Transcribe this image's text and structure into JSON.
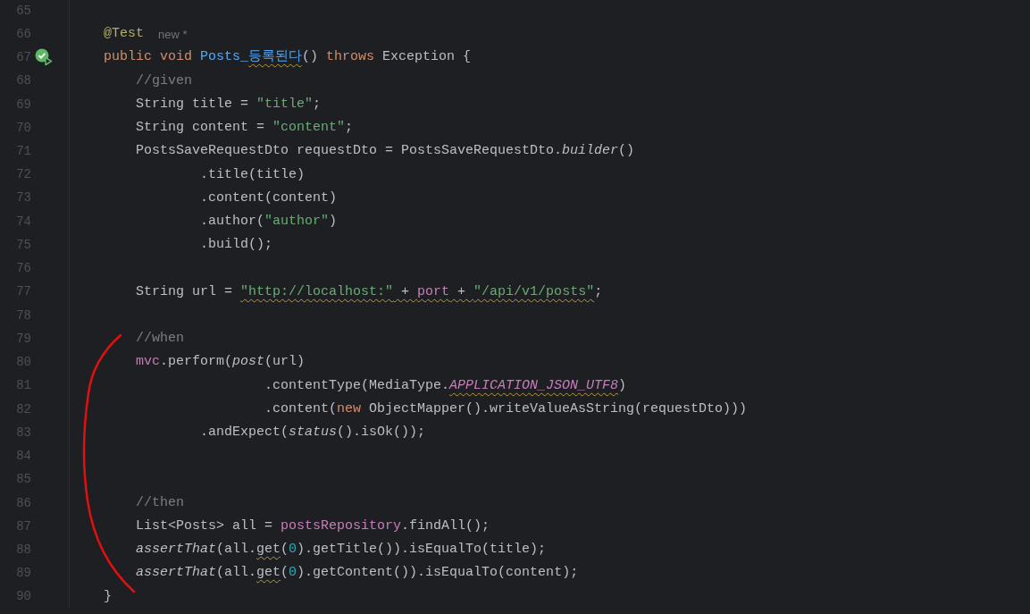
{
  "editor": {
    "lines": [
      {
        "number": "65"
      },
      {
        "number": "66",
        "kind": "top",
        "tokens": [
          {
            "annotation": "@Test"
          },
          {
            "hint": "new *"
          }
        ]
      },
      {
        "number": "67",
        "kind": "top",
        "run_icon": true,
        "tokens": [
          {
            "keyword": "public void "
          },
          {
            "declaration": "Posts_"
          },
          {
            "declaration": "등록된다",
            "warn": true
          },
          {
            "plain": "() "
          },
          {
            "keyword": "throws "
          },
          {
            "plain": "Exception {"
          }
        ]
      },
      {
        "number": "68",
        "kind": "body",
        "tokens": [
          {
            "comment": "//given"
          }
        ]
      },
      {
        "number": "69",
        "kind": "body",
        "tokens": [
          {
            "plain": "String title = "
          },
          {
            "string": "\"title\""
          },
          {
            "plain": ";"
          }
        ]
      },
      {
        "number": "70",
        "kind": "body",
        "tokens": [
          {
            "plain": "String content = "
          },
          {
            "string": "\"content\""
          },
          {
            "plain": ";"
          }
        ]
      },
      {
        "number": "71",
        "kind": "body",
        "tokens": [
          {
            "plain": "PostsSaveRequestDto requestDto = PostsSaveRequestDto."
          },
          {
            "italic": "builder"
          },
          {
            "plain": "()"
          }
        ]
      },
      {
        "number": "72",
        "kind": "chain",
        "tokens": [
          {
            "plain": ".title(title)"
          }
        ]
      },
      {
        "number": "73",
        "kind": "chain",
        "tokens": [
          {
            "plain": ".content(content)"
          }
        ]
      },
      {
        "number": "74",
        "kind": "chain",
        "tokens": [
          {
            "plain": ".author("
          },
          {
            "string": "\"author\""
          },
          {
            "plain": ")"
          }
        ]
      },
      {
        "number": "75",
        "kind": "chain",
        "tokens": [
          {
            "plain": ".build();"
          }
        ]
      },
      {
        "number": "76"
      },
      {
        "number": "77",
        "kind": "body",
        "tokens": [
          {
            "plain": "String url = "
          },
          {
            "string": "\"http://localhost:\"",
            "warn": true
          },
          {
            "plain": " + ",
            "warn": true
          },
          {
            "field": "port",
            "warn": true
          },
          {
            "plain": " + ",
            "warn": true
          },
          {
            "string": "\"/api/v1/posts\"",
            "warn": true
          },
          {
            "plain": ";"
          }
        ]
      },
      {
        "number": "78"
      },
      {
        "number": "79",
        "kind": "body",
        "tokens": [
          {
            "comment": "//when"
          }
        ]
      },
      {
        "number": "80",
        "kind": "body",
        "tokens": [
          {
            "field": "mvc"
          },
          {
            "plain": ".perform("
          },
          {
            "italic": "post"
          },
          {
            "plain": "(url)"
          }
        ]
      },
      {
        "number": "81",
        "kind": "chain_deep",
        "tokens": [
          {
            "plain": ".contentType(MediaType."
          },
          {
            "constant": "APPLICATION_JSON_UTF8",
            "warn": true
          },
          {
            "plain": ")"
          }
        ]
      },
      {
        "number": "82",
        "kind": "chain_deep",
        "tokens": [
          {
            "plain": ".content("
          },
          {
            "keyword": "new "
          },
          {
            "plain": "ObjectMapper().writeValueAsString(requestDto)))"
          }
        ]
      },
      {
        "number": "83",
        "kind": "chain",
        "tokens": [
          {
            "plain": ".andExpect("
          },
          {
            "italic": "status"
          },
          {
            "plain": "().isOk());"
          }
        ]
      },
      {
        "number": "84"
      },
      {
        "number": "85"
      },
      {
        "number": "86",
        "kind": "body",
        "tokens": [
          {
            "comment": "//then"
          }
        ]
      },
      {
        "number": "87",
        "kind": "body",
        "tokens": [
          {
            "plain": "List<Posts> all = "
          },
          {
            "field": "postsRepository"
          },
          {
            "plain": ".findAll();"
          }
        ]
      },
      {
        "number": "88",
        "kind": "body",
        "tokens": [
          {
            "italic": "assertThat"
          },
          {
            "plain": "(all."
          },
          {
            "plain": "get",
            "warn": true
          },
          {
            "plain": "("
          },
          {
            "number": "0"
          },
          {
            "plain": ").getTitle()).isEqualTo(title);"
          }
        ]
      },
      {
        "number": "89",
        "kind": "body",
        "tokens": [
          {
            "italic": "assertThat"
          },
          {
            "plain": "(all."
          },
          {
            "plain": "get",
            "warn": true
          },
          {
            "plain": "("
          },
          {
            "number": "0"
          },
          {
            "plain": ").getContent()).isEqualTo(content);"
          }
        ]
      },
      {
        "number": "90",
        "kind": "top",
        "tokens": [
          {
            "plain": "}"
          }
        ]
      }
    ]
  }
}
